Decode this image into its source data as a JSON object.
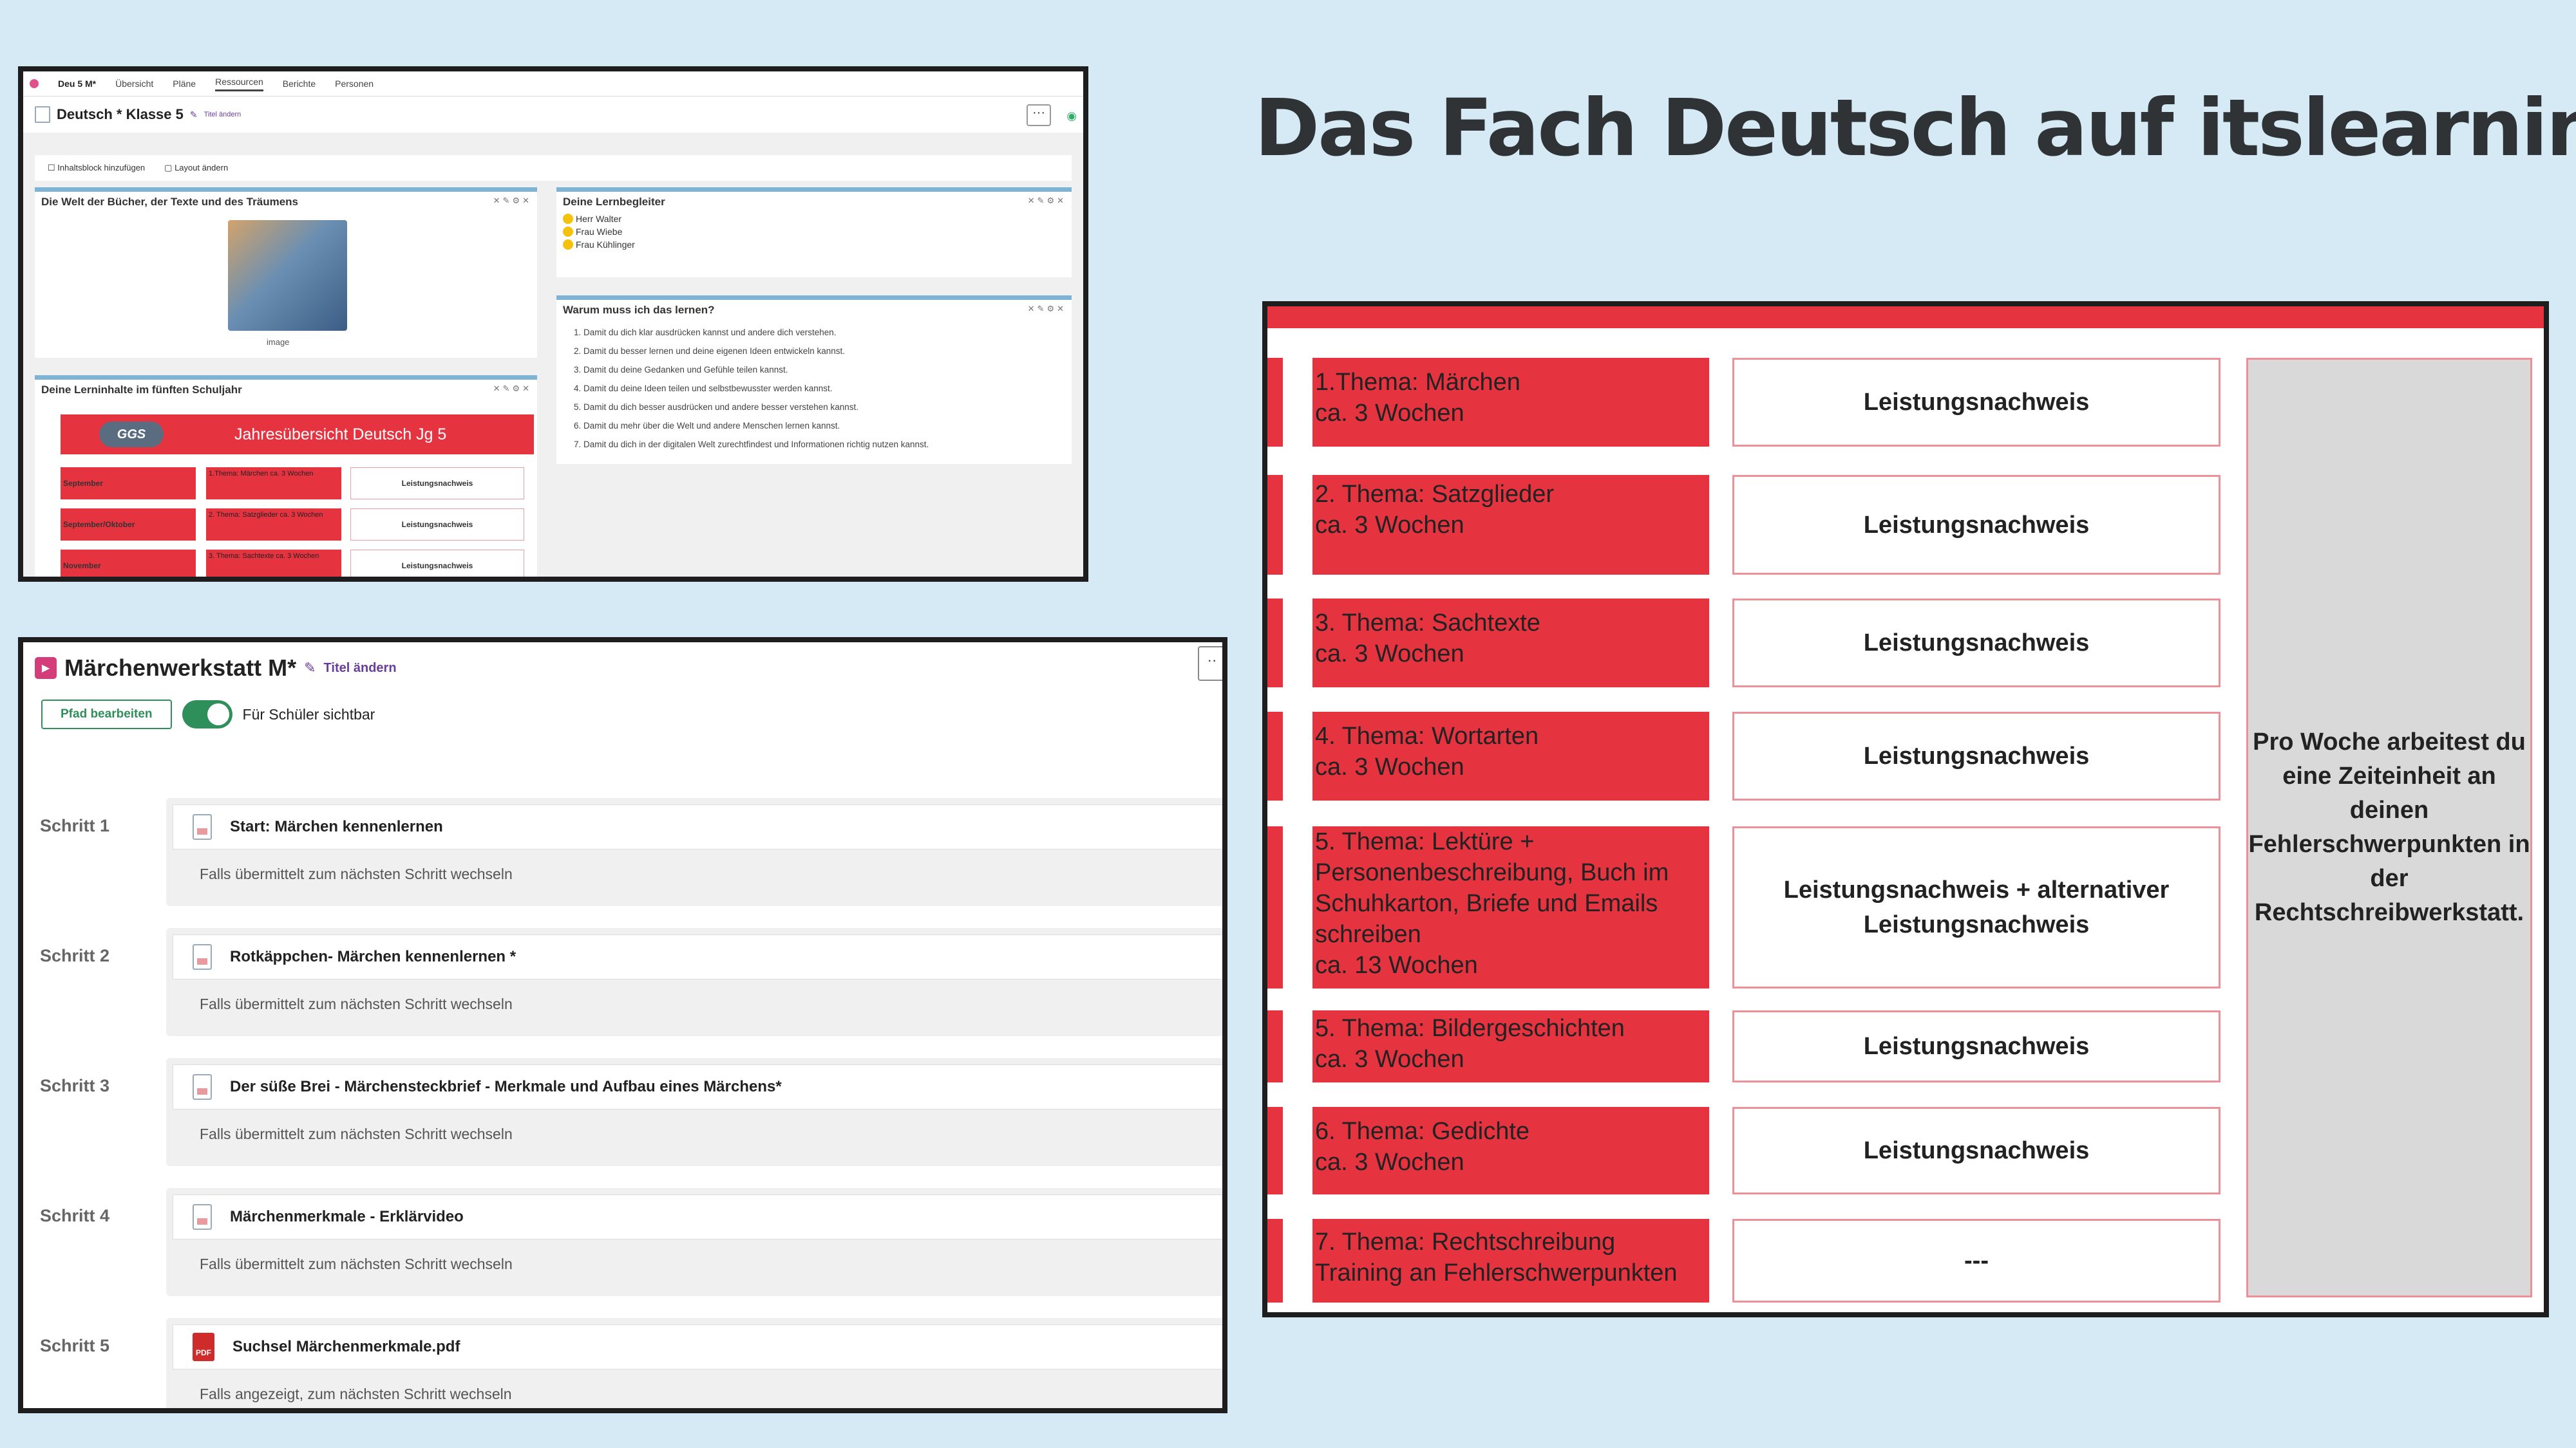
{
  "page_title": "Das Fach Deutsch auf itslearning",
  "shot1": {
    "course": "Deu 5 M*",
    "nav": [
      "Übersicht",
      "Pläne",
      "Ressourcen",
      "Berichte",
      "Personen"
    ],
    "header_title": "Deutsch * Klasse 5",
    "rename": "Titel ändern",
    "more": "···",
    "toolbar": {
      "add_block": "Inhaltsblock hinzufügen",
      "change_layout": "Layout ändern"
    },
    "widget_books": {
      "title": "Die Welt der Bücher, der Texte und des Träumens",
      "caption": "image"
    },
    "widget_companions": {
      "title": "Deine Lernbegleiter",
      "names": [
        "Herr Walter",
        "Frau Wiebe",
        "Frau Kühlinger"
      ]
    },
    "widget_why": {
      "title": "Warum muss ich das lernen?",
      "reasons": [
        "Damit du dich klar ausdrücken kannst und andere dich verstehen.",
        "Damit du besser lernen und deine eigenen Ideen entwickeln kannst.",
        "Damit du deine Gedanken und Gefühle teilen kannst.",
        "Damit du deine Ideen teilen und selbstbewusster werden kannst.",
        "Damit du dich besser ausdrücken und andere besser verstehen kannst.",
        "Damit du mehr über die Welt und andere Menschen lernen kannst.",
        "Damit du dich in der digitalen Welt zurechtfindest und Informationen richtig nutzen kannst."
      ]
    },
    "widget_content": {
      "title": "Deine Lerninhalte im fünften Schuljahr",
      "logo": "GGS",
      "banner": "Jahresübersicht Deutsch Jg 5",
      "rows": [
        {
          "month": "September",
          "topic": "1.Thema: Märchen ca. 3 Wochen",
          "ln": "Leistungsnachweis"
        },
        {
          "month": "September/Oktober",
          "topic": "2. Thema: Satzglieder ca. 3 Wochen",
          "ln": "Leistungsnachweis"
        },
        {
          "month": "November",
          "topic": "3. Thema: Sachtexte ca. 3 Wochen",
          "ln": "Leistungsnachweis"
        }
      ]
    }
  },
  "shot2": {
    "title": "Märchenwerkstatt M*",
    "rename": "Titel ändern",
    "more": "··",
    "edit_path": "Pfad bearbeiten",
    "visible_label": "Für Schüler sichtbar",
    "steps": [
      {
        "label": "Schritt 1",
        "name": "Start: Märchen kennenlernen",
        "cond": "Falls übermittelt zum nächsten Schritt wechseln"
      },
      {
        "label": "Schritt 2",
        "name": "Rotkäppchen- Märchen kennenlernen *",
        "cond": "Falls übermittelt zum nächsten Schritt wechseln"
      },
      {
        "label": "Schritt 3",
        "name": "Der süße Brei - Märchensteckbrief - Merkmale und Aufbau eines Märchens*",
        "cond": "Falls übermittelt zum nächsten Schritt wechseln"
      },
      {
        "label": "Schritt 4",
        "name": "Märchenmerkmale - Erklärvideo",
        "cond": "Falls übermittelt zum nächsten Schritt wechseln"
      },
      {
        "label": "Schritt 5",
        "name": "Suchsel Märchenmerkmale.pdf",
        "cond": "Falls angezeigt, zum nächsten Schritt wechseln",
        "file_badge": "PDF"
      }
    ]
  },
  "shot3": {
    "rows": [
      {
        "topic": "1.Thema: Märchen\nca. 3 Wochen",
        "ln": "Leistungsnachweis"
      },
      {
        "topic": " 2. Thema: Satzglieder\nca.  3 Wochen",
        "ln": "Leistungsnachweis"
      },
      {
        "topic": "3. Thema: Sachtexte\nca. 3 Wochen",
        "ln": "Leistungsnachweis"
      },
      {
        "topic": "4. Thema: Wortarten\nca. 3 Wochen",
        "ln": "Leistungsnachweis"
      },
      {
        "topic": "5. Thema: Lektüre +\nPersonenbeschreibung, Buch im\nSchuhkarton, Briefe und Emails\nschreiben\nca. 13 Wochen",
        "ln": "Leistungsnachweis + alternativer\nLeistungsnachweis"
      },
      {
        "topic": "5. Thema: Bildergeschichten\nca. 3 Wochen",
        "ln": "Leistungsnachweis"
      },
      {
        "topic": "6. Thema: Gedichte\nca. 3 Wochen",
        "ln": "Leistungsnachweis"
      },
      {
        "topic": "7. Thema: Rechtschreibung\nTraining an Fehlerschwerpunkten",
        "ln": "---"
      }
    ],
    "note": "Pro Woche arbeitest du eine Zeiteinheit an deinen Fehlerschwerpunkten in der Rechtschreibwerkstatt."
  },
  "colors": {
    "background": "#d5eaf5",
    "red": "#e63340",
    "green": "#2f8f5b",
    "purple": "#6a3c9c",
    "frame": "#1e1e1e"
  }
}
